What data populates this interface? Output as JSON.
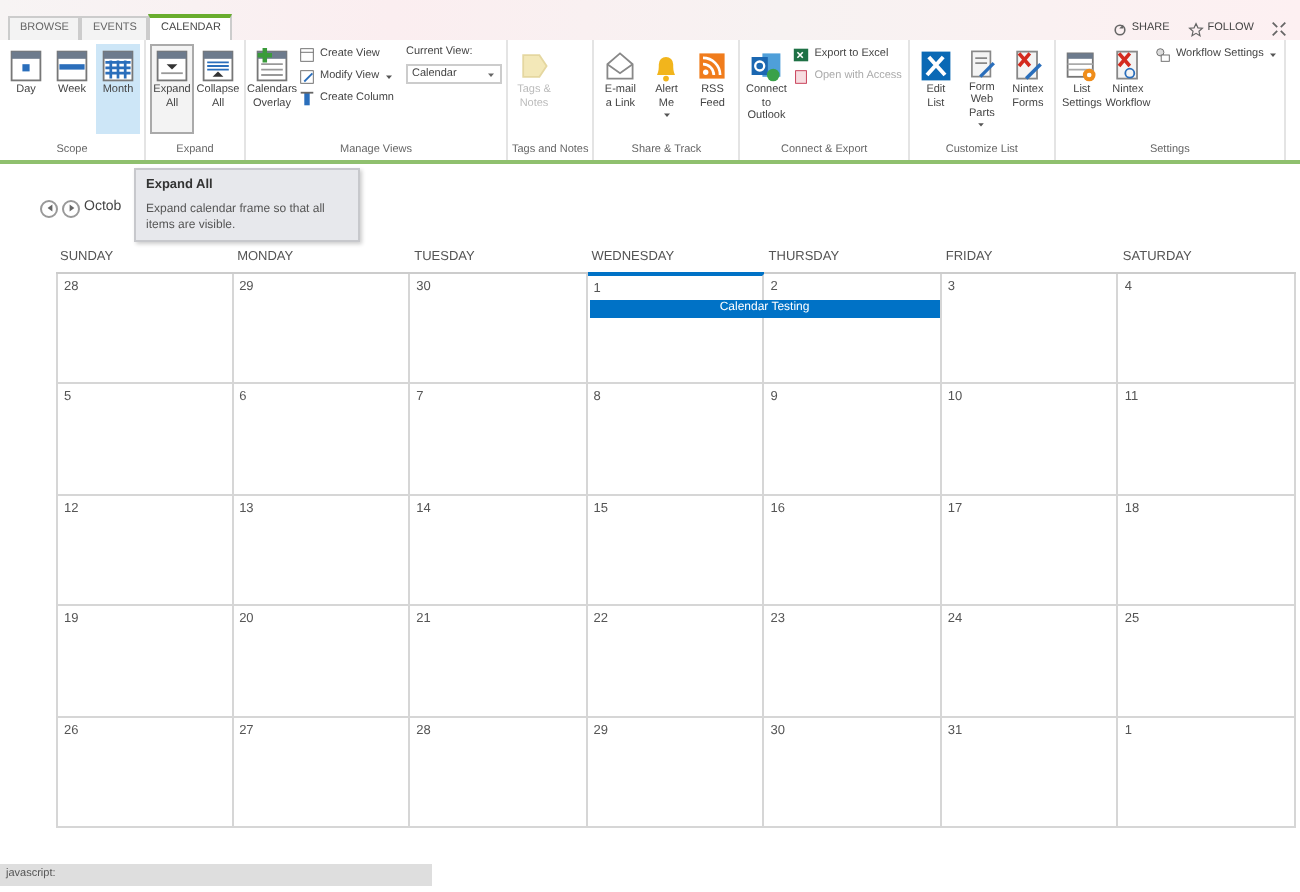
{
  "tabs": [
    {
      "label": "BROWSE",
      "selected": false
    },
    {
      "label": "EVENTS",
      "selected": false
    },
    {
      "label": "CALENDAR",
      "selected": true
    }
  ],
  "top_actions": [
    {
      "label": "SHARE",
      "kind": "share"
    },
    {
      "label": "FOLLOW",
      "kind": "follow"
    },
    {
      "kind": "focus"
    }
  ],
  "ribbon": [
    {
      "label": "Scope",
      "items": [
        {
          "kind": "large",
          "label": "Day",
          "selected": false,
          "hovered": false
        },
        {
          "kind": "large",
          "label": "Week",
          "selected": false,
          "hovered": false
        },
        {
          "kind": "large",
          "label": "Month",
          "selected": true,
          "hovered": false
        }
      ]
    },
    {
      "label": "Expand",
      "items": [
        {
          "kind": "large",
          "label": "Expand All",
          "selected": false,
          "hovered": true
        },
        {
          "kind": "large",
          "label": "Collapse All",
          "selected": false,
          "hovered": false
        }
      ]
    },
    {
      "label": "Manage Views",
      "items": [
        {
          "kind": "large",
          "label": "Calendars Overlay"
        },
        {
          "kind": "small",
          "label": "Create View",
          "dropdown": false,
          "disabled": false
        },
        {
          "kind": "small",
          "label": "Modify View",
          "dropdown": true,
          "disabled": false
        },
        {
          "kind": "small",
          "label": "Create Column",
          "dropdown": false,
          "disabled": false
        },
        {
          "kind": "select",
          "label": "Current View:",
          "value": "Calendar"
        }
      ]
    },
    {
      "label": "Tags and Notes",
      "items": [
        {
          "kind": "large",
          "label": "Tags & Notes",
          "disabled": true
        }
      ]
    },
    {
      "label": "Share & Track",
      "items": [
        {
          "kind": "large",
          "label": "E-mail a Link"
        },
        {
          "kind": "large",
          "label": "Alert Me",
          "dropdown": true
        },
        {
          "kind": "large",
          "label": "RSS Feed"
        }
      ]
    },
    {
      "label": "Connect & Export",
      "items": [
        {
          "kind": "large",
          "label": "Connect to Outlook"
        },
        {
          "kind": "small",
          "label": "Export to Excel",
          "dropdown": false,
          "disabled": false
        },
        {
          "kind": "small",
          "label": "Open with Access",
          "dropdown": false,
          "disabled": true
        }
      ]
    },
    {
      "label": "Customize List",
      "items": [
        {
          "kind": "large",
          "label": "Edit List"
        },
        {
          "kind": "large",
          "label": "Form Web Parts",
          "dropdown": true
        },
        {
          "kind": "large",
          "label": "Nintex Forms"
        }
      ]
    },
    {
      "label": "Settings",
      "items": [
        {
          "kind": "large",
          "label": "List Settings"
        },
        {
          "kind": "large",
          "label": "Nintex Workflow"
        },
        {
          "kind": "small",
          "label": "Workflow Settings",
          "dropdown": true,
          "disabled": false
        }
      ]
    }
  ],
  "month_label": "Octob",
  "tooltip": {
    "title": "Expand All",
    "text": "Expand calendar frame so that all items are visible."
  },
  "weekdays": [
    {
      "label": "SUNDAY",
      "today": false
    },
    {
      "label": "MONDAY",
      "today": false
    },
    {
      "label": "TUESDAY",
      "today": false
    },
    {
      "label": "WEDNESDAY",
      "today": true
    },
    {
      "label": "THURSDAY",
      "today": false
    },
    {
      "label": "FRIDAY",
      "today": false
    },
    {
      "label": "SATURDAY",
      "today": false
    }
  ],
  "weeks": [
    {
      "days": [
        {
          "day": "28"
        },
        {
          "day": "29"
        },
        {
          "day": "30"
        },
        {
          "day": "1",
          "event": {
            "title": "Calendar Testing"
          }
        },
        {
          "day": "2",
          "event_continues": true
        },
        {
          "day": "3"
        },
        {
          "day": "4"
        }
      ]
    },
    {
      "days": [
        {
          "day": "5"
        },
        {
          "day": "6"
        },
        {
          "day": "7"
        },
        {
          "day": "8"
        },
        {
          "day": "9"
        },
        {
          "day": "10"
        },
        {
          "day": "11"
        }
      ]
    },
    {
      "days": [
        {
          "day": "12"
        },
        {
          "day": "13"
        },
        {
          "day": "14"
        },
        {
          "day": "15"
        },
        {
          "day": "16"
        },
        {
          "day": "17"
        },
        {
          "day": "18"
        }
      ]
    },
    {
      "days": [
        {
          "day": "19"
        },
        {
          "day": "20"
        },
        {
          "day": "21"
        },
        {
          "day": "22"
        },
        {
          "day": "23"
        },
        {
          "day": "24"
        },
        {
          "day": "25"
        }
      ]
    },
    {
      "days": [
        {
          "day": "26"
        },
        {
          "day": "27"
        },
        {
          "day": "28"
        },
        {
          "day": "29"
        },
        {
          "day": "30"
        },
        {
          "day": "31"
        },
        {
          "day": "1"
        }
      ]
    }
  ],
  "status_bar": {
    "text": "javascript:"
  }
}
